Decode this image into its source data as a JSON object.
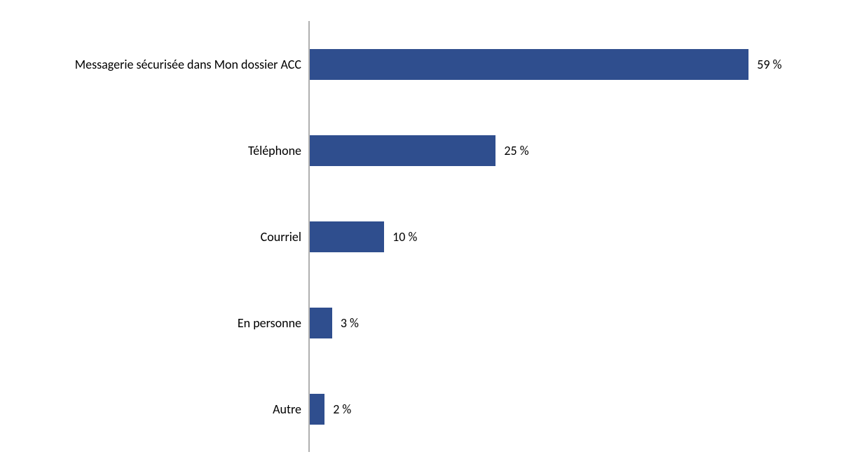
{
  "chart_data": {
    "type": "bar",
    "orientation": "horizontal",
    "categories": [
      "Messagerie sécurisée dans Mon dossier ACC",
      "Téléphone",
      "Courriel",
      "En personne",
      "Autre"
    ],
    "values": [
      59,
      25,
      10,
      3,
      2
    ],
    "value_labels": [
      "59 %",
      "25 %",
      "10 %",
      "3 %",
      "2 %"
    ],
    "xlim": [
      0,
      65
    ],
    "bar_color": "#2f4e8e",
    "axis_color": "#b0b0b0"
  }
}
